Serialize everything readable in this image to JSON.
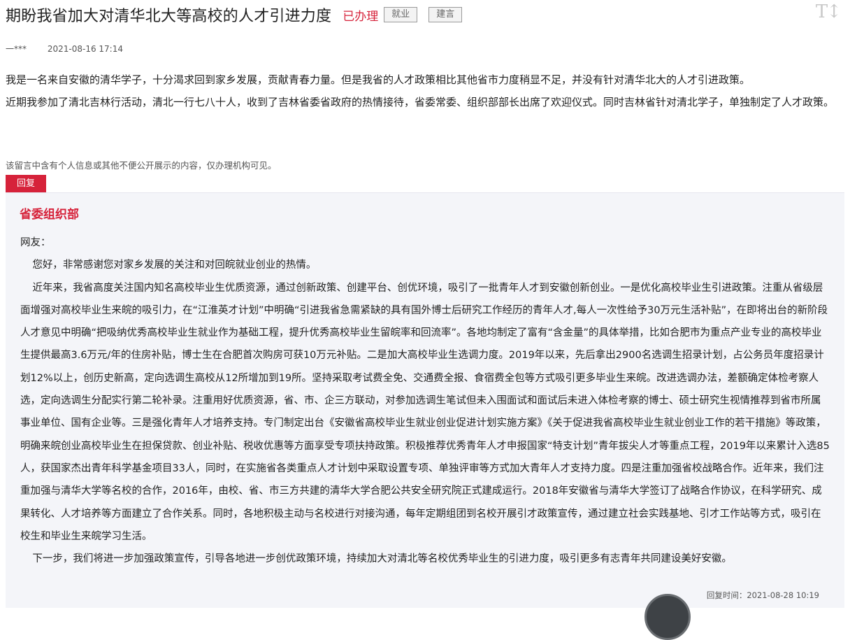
{
  "header": {
    "title": "期盼我省加大对清华北大等高校的人才引进力度",
    "status": "已办理",
    "tags": [
      "就业",
      "建言"
    ],
    "font_toggle_icon": "text-size-icon",
    "font_toggle_text": "T↕"
  },
  "meta": {
    "author": "一***",
    "date": "2021-08-16 17:14"
  },
  "message": {
    "paragraphs": [
      "我是一名来自安徽的清华学子，十分渴求回到家乡发展，贡献青春力量。但是我省的人才政策相比其他省市力度稍显不足，并没有针对清华北大的人才引进政策。",
      "近期我参加了清北吉林行活动，清北一行七八十人，收到了吉林省委省政府的热情接待，省委常委、组织部部长出席了欢迎仪式。同时吉林省针对清北学子，单独制定了人才政策。"
    ],
    "notice": "该留言中含有个人信息或其他不便公开展示的内容，仅办理机构可见。"
  },
  "reply": {
    "button_label": "回复",
    "department": "省委组织部",
    "salutation": "网友：",
    "paragraphs": [
      "您好，非常感谢您对家乡发展的关注和对回皖就业创业的热情。",
      "近年来，我省高度关注国内知名高校毕业生优质资源，通过创新政策、创建平台、创优环境，吸引了一批青年人才到安徽创新创业。一是优化高校毕业生引进政策。注重从省级层面增强对高校毕业生来皖的吸引力，在“江淮英才计划”中明确“引进我省急需紧缺的具有国外博士后研究工作经历的青年人才,每人一次性给予30万元生活补贴”，在即将出台的新阶段人才意见中明确“把吸纳优秀高校毕业生就业作为基础工程，提升优秀高校毕业生留皖率和回流率”。各地均制定了富有“含金量”的具体举措，比如合肥市为重点产业专业的高校毕业生提供最高3.6万元/年的住房补贴，博士生在合肥首次购房可获10万元补贴。二是加大高校毕业生选调力度。2019年以来，先后拿出2900名选调生招录计划，占公务员年度招录计划12%以上，创历史新高，定向选调生高校从12所增加到19所。坚持采取考试费全免、交通费全报、食宿费全包等方式吸引更多毕业生来皖。改进选调办法，差额确定体检考察人选，定向选调生分配实行第二轮补录。注重用好优质资源，省、市、企三方联动，对参加选调生笔试但未入围面试和面试后未进入体检考察的博士、硕士研究生视情推荐到省市所属事业单位、国有企业等。三是强化青年人才培养支持。专门制定出台《安徽省高校毕业生就业创业促进计划实施方案》《关于促进我省高校毕业生就业创业工作的若干措施》等政策，明确来皖创业高校毕业生在担保贷款、创业补贴、税收优惠等方面享受专项扶持政策。积极推荐优秀青年人才申报国家“特支计划”青年拔尖人才等重点工程，2019年以来累计入选85人，获国家杰出青年科学基金项目33人，同时，在实施省各类重点人才计划中采取设置专项、单独评审等方式加大青年人才支持力度。四是注重加强省校战略合作。近年来，我们注重加强与清华大学等名校的合作，2016年，由校、省、市三方共建的清华大学合肥公共安全研究院正式建成运行。2018年安徽省与清华大学签订了战略合作协议，在科学研究、成果转化、人才培养等方面建立了合作关系。同时，各地积极主动与名校进行对接沟通，每年定期组团到名校开展引才政策宣传，通过建立社会实践基地、引才工作站等方式，吸引在校生和毕业生来皖学习生活。",
      "下一步，我们将进一步加强政策宣传，引导各地进一步创优政策环境，持续加大对清北等名校优秀毕业生的引进力度，吸引更多有志青年共同建设美好安徽。"
    ],
    "reply_time": "回复时间：2021-08-28 10:19"
  },
  "colors": {
    "accent": "#d6223a",
    "panel_bg": "#f4f5f9"
  }
}
